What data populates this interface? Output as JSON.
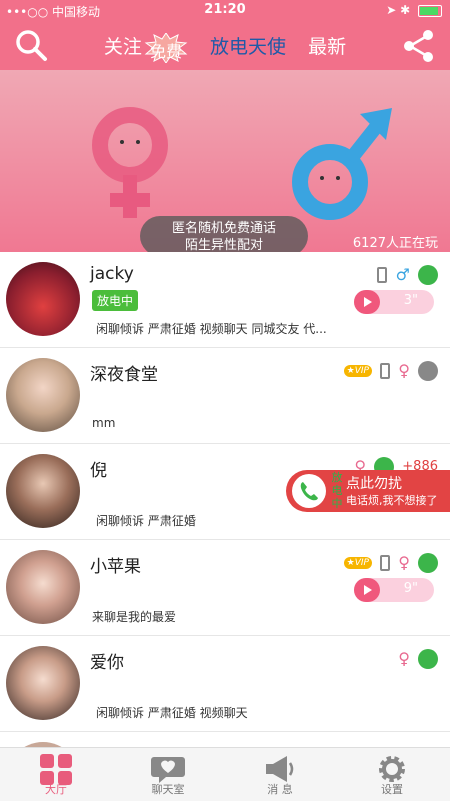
{
  "status_bar": {
    "carrier": "•••○○ 中国移动",
    "time": "21:20"
  },
  "header": {
    "tabs": [
      {
        "label": "关注",
        "active": false
      },
      {
        "label": "放电天使",
        "active": true
      },
      {
        "label": "最新",
        "active": false
      }
    ],
    "free_badge": "免费",
    "colors": {
      "bar": "#f2708a",
      "active_tab": "#1e5aa8"
    }
  },
  "banner": {
    "line1": "匿名随机免费通话",
    "line2": "陌生异性配对",
    "online_count": "6127人正在玩"
  },
  "users": [
    {
      "name": "jacky",
      "status": "放电中",
      "tagline": "闲聊倾诉 严肃征婚 视频聊天 同城交友 代...",
      "duration": "3\""
    },
    {
      "name": "深夜食堂",
      "vip": "VIP",
      "tagline": "mm"
    },
    {
      "name": "倪",
      "price": "+886",
      "tagline": "闲聊倾诉 严肃征婚"
    },
    {
      "name": "小苹果",
      "vip": "VIP",
      "tagline": "来聊是我的最爱",
      "duration": "9\""
    },
    {
      "name": "爱你",
      "tagline": "闲聊倾诉 严肃征婚 视频聊天"
    }
  ],
  "popup": {
    "vertical": "放电中",
    "title": "点此勿扰",
    "subtitle": "电话烦,我不想接了"
  },
  "tabbar": [
    {
      "label": "大厅",
      "icon": "hall-icon"
    },
    {
      "label": "聊天室",
      "icon": "chat-room-icon"
    },
    {
      "label": "消 息",
      "icon": "megaphone-icon"
    },
    {
      "label": "设置",
      "icon": "gear-icon"
    }
  ]
}
